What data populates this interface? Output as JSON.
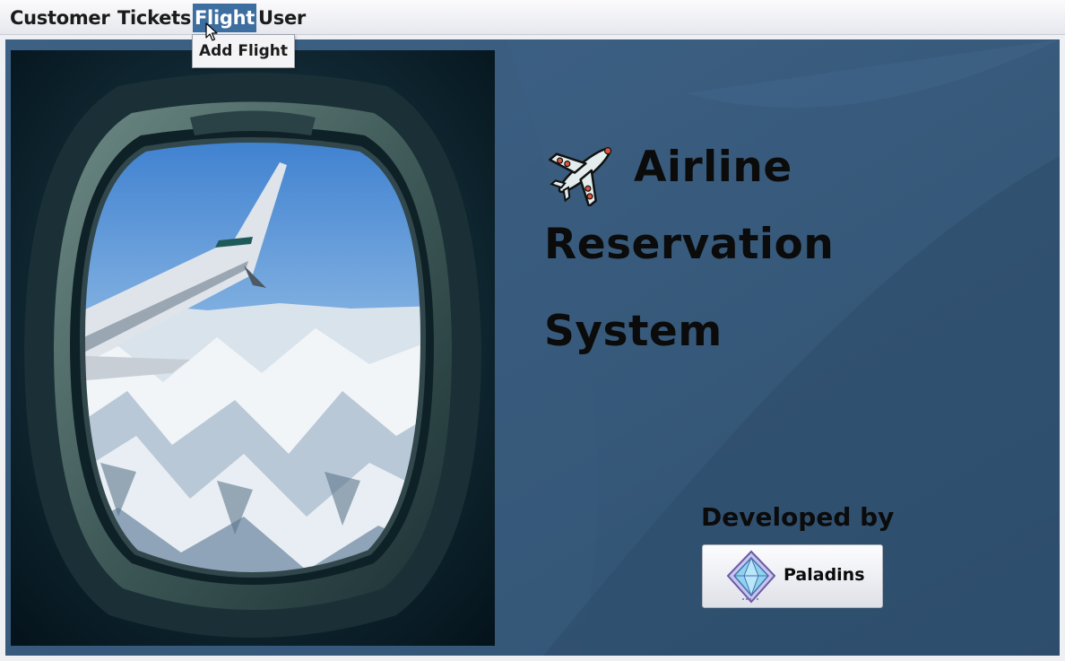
{
  "menubar": {
    "items": [
      {
        "label": "Customer"
      },
      {
        "label": "Tickets"
      },
      {
        "label": "Flight"
      },
      {
        "label": "User"
      }
    ],
    "active_menu": "Flight"
  },
  "dropdown": {
    "items": [
      {
        "label": "Add Flight"
      }
    ]
  },
  "main": {
    "title_lines": [
      "Airline",
      "Reservation",
      "System"
    ],
    "developed_by_label": "Developed by",
    "developer_name": "Paladins"
  },
  "colors": {
    "panel_background": "#385a7c",
    "menu_active": "#3d6ea0",
    "title_text": "#0b0b0b"
  },
  "icons": {
    "title_icon": "airplane-icon",
    "developer_logo": "paladins-logo-icon",
    "pointer": "mouse-cursor-icon"
  }
}
